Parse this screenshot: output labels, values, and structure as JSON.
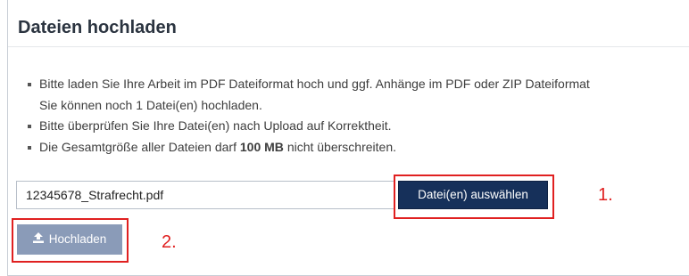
{
  "section": {
    "title": "Dateien hochladen"
  },
  "instructions": [
    "Bitte laden Sie Ihre Arbeit im PDF Dateiformat hoch und ggf. Anhänge im PDF oder ZIP Dateiformat",
    "Sie können noch 1 Datei(en) hochladen.",
    "Bitte überprüfen Sie Ihre Datei(en) nach Upload auf Korrektheit.",
    "Die Gesamtgröße aller Dateien darf",
    "100 MB",
    "nicht überschreiten."
  ],
  "file": {
    "value": "12345678_Strafrecht.pdf",
    "choose_label": "Datei(en) auswählen"
  },
  "upload": {
    "label": "Hochladen",
    "icon": "upload-icon"
  },
  "annotations": {
    "step1": "1.",
    "step2": "2."
  },
  "colors": {
    "primary": "#16305a",
    "upload_disabled": "#8a9bb8",
    "annotation": "#e02020"
  }
}
